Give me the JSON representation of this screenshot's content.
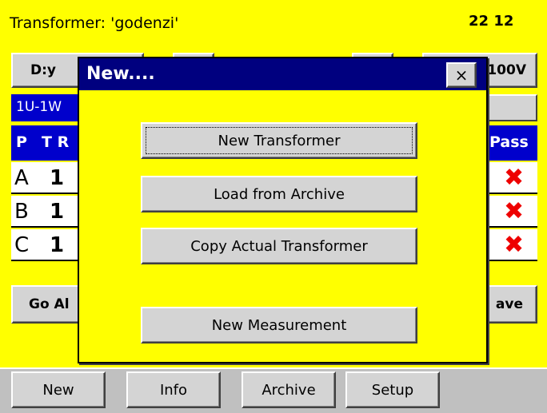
{
  "header": {
    "title": "Transformer: 'godenzi'",
    "clock": "22 12"
  },
  "toolbar": {
    "vector_group_label": "D:y",
    "voltage_label": "100V"
  },
  "band": {
    "text": "1U-1W"
  },
  "table": {
    "headers": {
      "phase": "P",
      "tr": "T R",
      "pass": "Pass"
    },
    "rows": [
      {
        "phase": "A",
        "value": "1"
      },
      {
        "phase": "B",
        "value": "1"
      },
      {
        "phase": "C",
        "value": "1"
      }
    ]
  },
  "actions": {
    "go_all_label": "Go Al",
    "save_label": "ave"
  },
  "taskbar": {
    "new_label": "New",
    "info_label": "Info",
    "archive_label": "Archive",
    "setup_label": "Setup"
  },
  "dialog": {
    "title": "New....",
    "close_glyph": "×",
    "buttons": {
      "new_transformer": "New Transformer",
      "load_from_archive": "Load from Archive",
      "copy_actual_transformer": "Copy Actual Transformer",
      "new_measurement": "New Measurement"
    }
  },
  "colors": {
    "background": "#ffff00",
    "band_blue": "#0000cc",
    "dialog_title": "#00007f",
    "fail_red": "#ee0000"
  },
  "icons": {
    "fail": "x-mark-icon"
  }
}
